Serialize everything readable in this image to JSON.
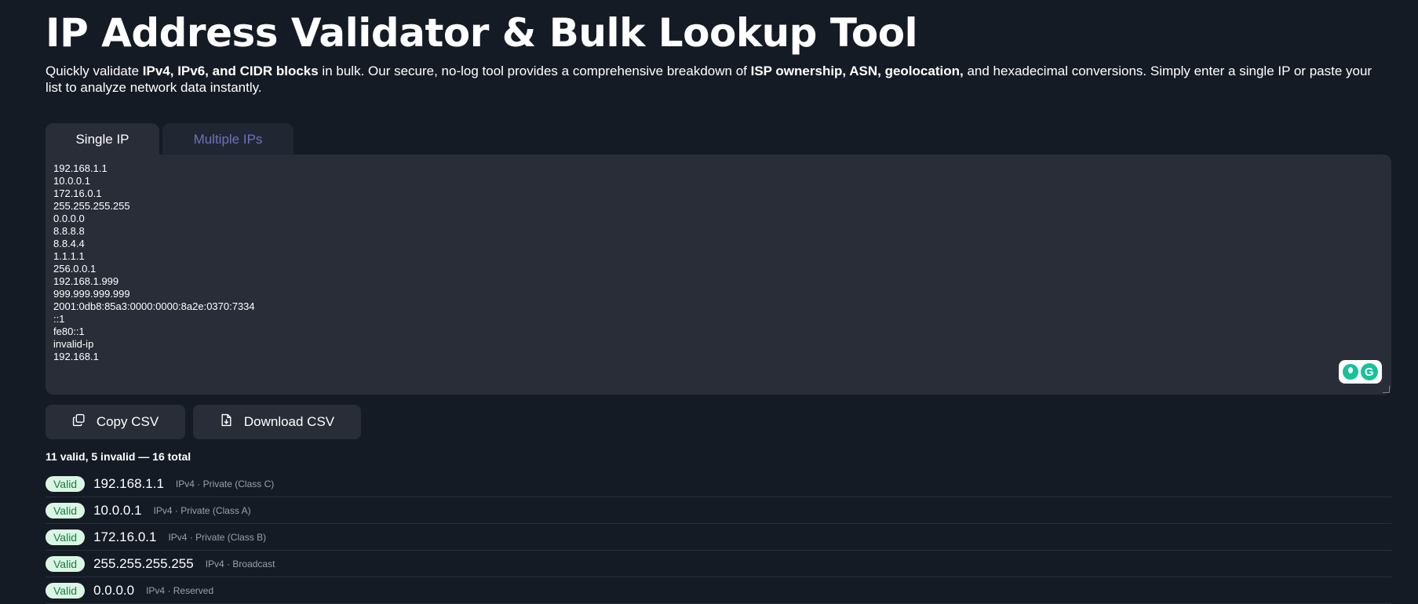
{
  "page": {
    "title": "IP Address Validator & Bulk Lookup Tool",
    "intro": {
      "t1": "Quickly validate ",
      "b1": "IPv4, IPv6, and CIDR blocks",
      "t2": " in bulk. Our secure, no-log tool provides a comprehensive breakdown of ",
      "b2": "ISP ownership, ASN, geolocation,",
      "t3": " and hexadecimal conversions. Simply enter a single IP or paste your list to analyze network data instantly."
    }
  },
  "tabs": [
    {
      "label": "Single IP",
      "active": true
    },
    {
      "label": "Multiple IPs",
      "active": false
    }
  ],
  "editor": {
    "value": "192.168.1.1\n10.0.0.1\n172.16.0.1\n255.255.255.255\n0.0.0.0\n8.8.8.8\n8.8.4.4\n1.1.1.1\n256.0.0.1\n192.168.1.999\n999.999.999.999\n2001:0db8:85a3:0000:0000:8a2e:0370:7334\n::1\nfe80::1\ninvalid-ip\n192.168.1"
  },
  "actions": {
    "copy_label": "Copy CSV",
    "download_label": "Download CSV",
    "copy_icon": "copy-icon",
    "download_icon": "file-download-icon"
  },
  "summary": "11 valid, 5 invalid — 16 total",
  "results": [
    {
      "status": "Valid",
      "ip": "192.168.1.1",
      "desc": "IPv4 · Private (Class C)"
    },
    {
      "status": "Valid",
      "ip": "10.0.0.1",
      "desc": "IPv4 · Private (Class A)"
    },
    {
      "status": "Valid",
      "ip": "172.16.0.1",
      "desc": "IPv4 · Private (Class B)"
    },
    {
      "status": "Valid",
      "ip": "255.255.255.255",
      "desc": "IPv4 · Broadcast"
    },
    {
      "status": "Valid",
      "ip": "0.0.0.0",
      "desc": "IPv4 · Reserved"
    }
  ],
  "colors": {
    "background": "#151b25",
    "panel": "#282d38",
    "inactive_tab_text": "#6d72b9",
    "valid_badge_bg": "#d9f7e4",
    "valid_badge_text": "#1c7a43"
  }
}
